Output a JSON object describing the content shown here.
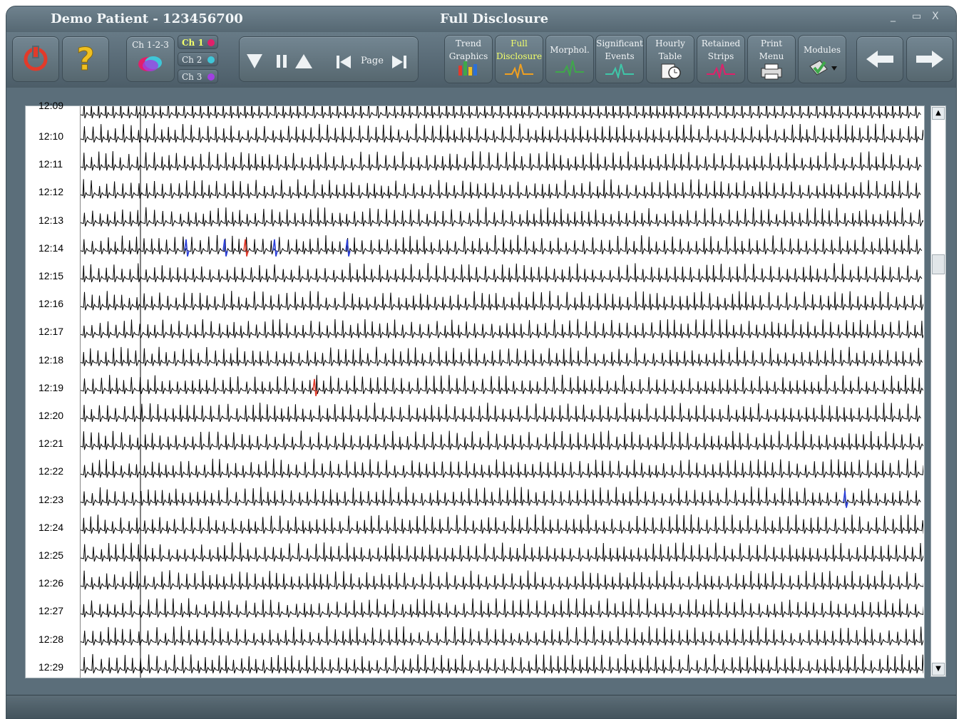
{
  "window": {
    "patient_title": "Demo Patient - 123456700",
    "view_title": "Full Disclosure",
    "minimize": "_",
    "maximize": "▭",
    "close": "X"
  },
  "toolbar": {
    "power_icon": "power-icon",
    "help_icon": "help-icon",
    "channels_all_label": "Ch 1-2-3",
    "ch1_label": "Ch 1",
    "ch2_label": "Ch 2",
    "ch3_label": "Ch 3",
    "ch1_color": "#e0206a",
    "ch2_color": "#3fc6d8",
    "ch3_color": "#a040e0",
    "page_label": "Page",
    "trend_label_1": "Trend",
    "trend_label_2": "Graphics",
    "full_label_1": "Full",
    "full_label_2": "Disclosure",
    "morphol_label": "Morphol.",
    "significant_label_1": "Significant",
    "significant_label_2": "Events",
    "hourly_label_1": "Hourly",
    "hourly_label_2": "Table",
    "retained_label_1": "Retained",
    "retained_label_2": "Strips",
    "print_label_1": "Print",
    "print_label_2": "Menu",
    "modules_label": "Modules",
    "active_color": "#f2ff6a"
  },
  "disclosure": {
    "partial_top_label": "12:09",
    "rows": [
      "12:10",
      "12:11",
      "12:12",
      "12:13",
      "12:14",
      "12:15",
      "12:16",
      "12:17",
      "12:18",
      "12:19",
      "12:20",
      "12:21",
      "12:22",
      "12:23",
      "12:24",
      "12:25",
      "12:26",
      "12:27",
      "12:28",
      "12:29"
    ]
  },
  "scrollbar": {
    "up": "▲",
    "down": "▼",
    "position": 0.28
  }
}
